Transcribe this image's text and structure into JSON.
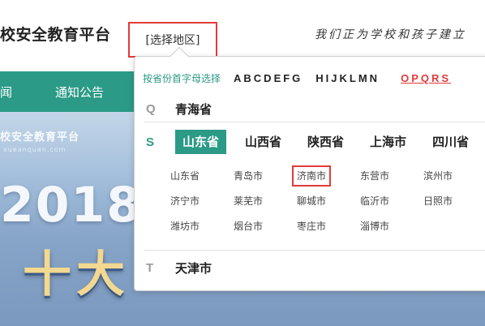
{
  "header": {
    "site_title": "校安全教育平台",
    "region_button": "[选择地区]",
    "slogan": "我们正为学校和孩子建立"
  },
  "nav": {
    "items": [
      "闻",
      "通知公告"
    ]
  },
  "banner": {
    "brand": "校安全教育平台",
    "url": "xueanquan.com",
    "year": "2018",
    "big_text": "十大"
  },
  "dropdown": {
    "letter_hint": "按省份首字母选择",
    "letter_groups": [
      "ABCDEFG",
      "HIJKLMN",
      "OPQRS"
    ],
    "active_letter_group": "OPQRS",
    "sections": [
      {
        "letter": "Q",
        "provinces": [
          "青海省"
        ]
      },
      {
        "letter": "S",
        "provinces": [
          "山东省",
          "山西省",
          "陕西省",
          "上海市",
          "四川省"
        ],
        "active_province": "山东省"
      },
      {
        "letter": "T",
        "provinces": [
          "天津市"
        ]
      }
    ],
    "cities": [
      "山东省",
      "青岛市",
      "济南市",
      "东营市",
      "滨州市",
      "济宁市",
      "莱芜市",
      "聊城市",
      "临沂市",
      "日照市",
      "潍坊市",
      "烟台市",
      "枣庄市",
      "淄博市"
    ],
    "selected_city": "济南市"
  },
  "colors": {
    "accent": "#2b9a86",
    "highlight": "#e23a3a"
  }
}
